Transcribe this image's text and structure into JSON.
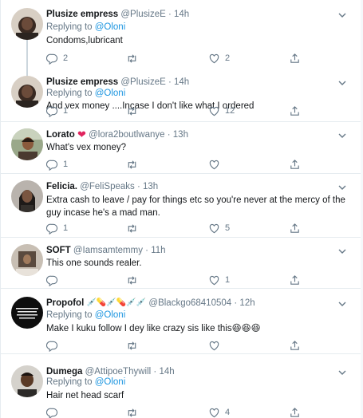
{
  "reply_prefix": "Replying to ",
  "tweets": [
    {
      "name": "Plusize empress",
      "handle": "@PlusizeE",
      "dot": "·",
      "time": "14h",
      "replying_to": "@Oloni",
      "text": "Condoms,lubricant",
      "replies": "2",
      "retweets": "",
      "likes": "2"
    },
    {
      "name": "Plusize empress",
      "handle": "@PlusizeE",
      "dot": "·",
      "time": "14h",
      "replying_to": "@Oloni",
      "text": "And vex money ....Incase I don't like what I ordered",
      "replies": "1",
      "retweets": "",
      "likes": "12"
    },
    {
      "name": "Lorato",
      "name_emoji": "❤",
      "handle": "@lora2boutlwanye",
      "dot": "·",
      "time": "13h",
      "text": "What's vex money?",
      "replies": "1",
      "retweets": "",
      "likes": ""
    },
    {
      "name": "Felicia.",
      "handle": "@FeliSpeaks",
      "dot": "·",
      "time": "13h",
      "text": "Extra cash to leave / pay for things etc so you're never at the mercy of the guy incase he's a mad man.",
      "replies": "1",
      "retweets": "",
      "likes": "5"
    },
    {
      "name": "SOFT",
      "handle": "@Iamsamtemmy",
      "dot": "·",
      "time": "11h",
      "text": "This one sounds realer.",
      "replies": "",
      "retweets": "",
      "likes": "1"
    },
    {
      "name": "Propofol",
      "name_emoji": "💉💊💉💊💉💉",
      "handle": "@Blackgo68410504",
      "dot": "·",
      "time": "12h",
      "replying_to": "@Oloni",
      "text": "Make I kuku follow I dey like crazy sis like this😆😆😆",
      "replies": "",
      "retweets": "",
      "likes": ""
    },
    {
      "name": "Dumega",
      "handle": "@AttipoeThywill",
      "dot": "·",
      "time": "14h",
      "replying_to": "@Oloni",
      "text": "Hair net head scarf",
      "replies": "",
      "retweets": "",
      "likes": "4"
    }
  ],
  "colors": {
    "text": "#14171a",
    "secondary": "#657786",
    "link": "#1b95e0",
    "border": "#e6ecf0",
    "thread_line": "#ccd6dd",
    "heart": "#e0245e"
  }
}
